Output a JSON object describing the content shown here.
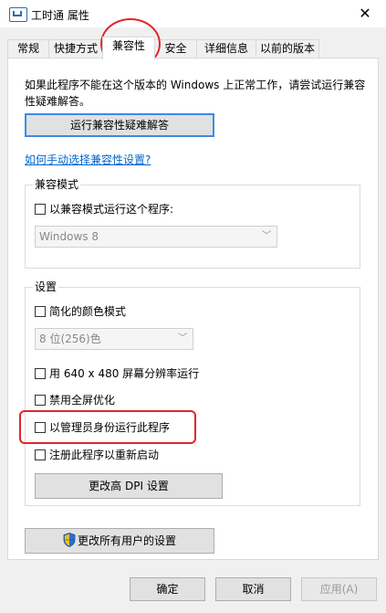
{
  "window": {
    "title": "工时通 属性",
    "close": "✕"
  },
  "tabs": [
    {
      "label": "常规"
    },
    {
      "label": "快捷方式"
    },
    {
      "label": "兼容性",
      "active": true
    },
    {
      "label": "安全"
    },
    {
      "label": "详细信息"
    },
    {
      "label": "以前的版本"
    }
  ],
  "compat": {
    "intro": "如果此程序不能在这个版本的 Windows 上正常工作，请尝试运行兼容性疑难解答。",
    "troubleshoot_button": "运行兼容性疑难解答",
    "manual_link": "如何手动选择兼容性设置?",
    "mode_group": {
      "title": "兼容模式",
      "checkbox": "以兼容模式运行这个程序:",
      "select_value": "Windows 8"
    },
    "settings_group": {
      "title": "设置",
      "reduced_color": "简化的颜色模式",
      "color_select": "8 位(256)色",
      "res_640": "用 640 x 480 屏幕分辨率运行",
      "disable_fullscreen": "禁用全屏优化",
      "run_as_admin": "以管理员身份运行此程序",
      "register_restart": "注册此程序以重新启动",
      "high_dpi_button": "更改高 DPI 设置"
    },
    "all_users_button": "更改所有用户的设置"
  },
  "footer": {
    "ok": "确定",
    "cancel": "取消",
    "apply": "应用(A)"
  },
  "colors": {
    "annotation": "#e0252b",
    "link": "#0066cc",
    "focus": "#3c8be8"
  },
  "icons": {
    "shield": "uac-shield-icon",
    "close": "close-icon",
    "dropdown": "chevron-down-icon"
  }
}
